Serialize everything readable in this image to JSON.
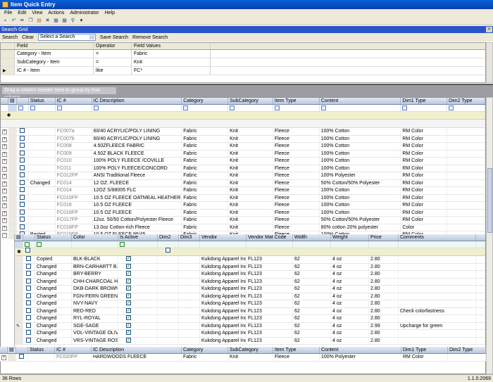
{
  "window": {
    "title": "Item Quick Entry"
  },
  "menu": [
    "File",
    "Edit",
    "View",
    "Actions",
    "Administrator",
    "Help"
  ],
  "search_grid": {
    "title": "Search Grid",
    "close": "×",
    "search_label": "Search",
    "clear_label": "Clear",
    "select_value": "Select a Search",
    "save_label": "Save Search",
    "remove_label": "Remove Search",
    "headers": [
      "Field",
      "Operator",
      "Field Values"
    ],
    "rows": [
      [
        "Category - Item",
        "=",
        "Fabric"
      ],
      [
        "SubCategory - Item",
        "=",
        "Knit"
      ],
      [
        "IC # - Item",
        "like",
        "FC*"
      ]
    ]
  },
  "group_hint": "Drag a column header here to group by that column.",
  "main_headers": [
    "Status",
    "IC #",
    "IC Description",
    "Category",
    "SubCategory",
    "Item Type",
    "Content",
    "Dim1 Type",
    "Dim2 Type"
  ],
  "main_rows": [
    [
      "",
      "FC007a",
      "60/40 ACRYLIC/POLY LINING",
      "Fabric",
      "Knit",
      "Fleece",
      "100% Cotton",
      "RM Color"
    ],
    [
      "",
      "FC007b",
      "60/40 ACRYLIC/POLY LINING",
      "Fabric",
      "Knit",
      "Fleece",
      "100% Cotton",
      "RM Color"
    ],
    [
      "",
      "FC008",
      "4.50ZFLEECE FABRIC",
      "Fabric",
      "Knit",
      "Fleece",
      "100% Cotton",
      "RM Color"
    ],
    [
      "",
      "FC009",
      "4.50Z BLACK FLEECE",
      "Fabric",
      "Knit",
      "Fleece",
      "100% Cotton",
      "RM Color"
    ],
    [
      "",
      "FC010",
      "100% POLY FLEECE /COVILLE",
      "Fabric",
      "Knit",
      "Fleece",
      "100% Cotton",
      "RM Color"
    ],
    [
      "",
      "FC011",
      "100% POLY FLEECE/CONCORD",
      "Fabric",
      "Knit",
      "Fleece",
      "100% Cotton",
      "RM Color"
    ],
    [
      "",
      "FC012FP",
      "ANSI Traditional Fleece",
      "Fabric",
      "Knit",
      "Fleece",
      "100% Polyester",
      "RM Color"
    ],
    [
      "Changed",
      "FC014",
      "12 OZ. FLEECE",
      "Fabric",
      "Knit",
      "Fleece",
      "50% Cotton/50% Polyester",
      "RM Color"
    ],
    [
      "",
      "FC014",
      "12OZ S/88005 FLC",
      "Fabric",
      "Knit",
      "Fleece",
      "100% Cotton",
      "RM Color"
    ],
    [
      "",
      "FC015FP",
      "10.5 OZ FLEECE OATMEAL HEATHER",
      "Fabric",
      "Knit",
      "Fleece",
      "100% Cotton",
      "RM Color"
    ],
    [
      "",
      "FC016",
      "10.5 OZ FLEECE",
      "Fabric",
      "Knit",
      "Fleece",
      "100% Cotton",
      "RM Color"
    ],
    [
      "",
      "FC016FP",
      "10.5 OZ FLEECE",
      "Fabric",
      "Knit",
      "Fleece",
      "100% Cotton",
      "RM Color"
    ],
    [
      "",
      "FC017FP",
      "12oz. 50/50 Cotton/Polyester Fleece",
      "Fabric",
      "Knit",
      "Fleece",
      "50% Cotton/50% Polyester",
      "RM Color"
    ],
    [
      "",
      "FC018FP",
      "13.0oz Cotton-rich Fleece",
      "Fabric",
      "Knit",
      "Fleece",
      "80% cotton 20% polyester",
      "Color"
    ],
    [
      "Pasted",
      "FC019FP",
      "10.5 OZ FLEECE 95/45",
      "Fabric",
      "Knit",
      "Fleece",
      "100% Cotton",
      "RM Color"
    ]
  ],
  "child_headers": [
    "Status",
    "Color",
    "Is Active",
    "Dim2",
    "Dim3",
    "Vendor",
    "Vendor Mat Code",
    "Width",
    "Weight",
    "Price",
    "Comments"
  ],
  "child_rows": [
    [
      "Copied",
      "BLK-BLACK",
      "Kukdong Apparel Inc.",
      "FL123",
      "62",
      "4 oz",
      "2.80",
      ""
    ],
    [
      "Changed",
      "BRN-CARHARTT B...",
      "Kukdong Apparel Inc.",
      "FL123",
      "62",
      "4 oz",
      "2.80",
      ""
    ],
    [
      "Changed",
      "BRY-BERRY",
      "Kukdong Apparel Inc.",
      "FL123",
      "62",
      "4 oz",
      "2.80",
      ""
    ],
    [
      "Changed",
      "CHH-CHARCOAL H...",
      "Kukdong Apparel Inc.",
      "FL123",
      "62",
      "4 oz",
      "2.80",
      ""
    ],
    [
      "Changed",
      "DKB-DARK BROWN",
      "Kukdong Apparel Inc.",
      "FL123",
      "62",
      "4 oz",
      "2.80",
      ""
    ],
    [
      "Changed",
      "FGN-FERN GREEN",
      "Kukdong Apparel Inc.",
      "FL123",
      "62",
      "4 oz",
      "2.80",
      ""
    ],
    [
      "Changed",
      "NVY-NAVY",
      "Kukdong Apparel Inc.",
      "FL123",
      "62",
      "4 oz",
      "2.80",
      ""
    ],
    [
      "Changed",
      "RED-RED",
      "Kukdong Apparel Inc.",
      "FL123",
      "62",
      "4 oz",
      "2.80",
      "Check colorfastness"
    ],
    [
      "Changed",
      "RYL-ROYAL",
      "Kukdong Apparel Inc.",
      "FL123",
      "62",
      "4 oz",
      "2.80",
      ""
    ],
    [
      "Changed",
      "SGE-SAGE",
      "Kukdong Apparel Inc.",
      "FL123",
      "62",
      "4 oz",
      "2.99",
      "Upcharge for green"
    ],
    [
      "Changed",
      "VOL-VINTAGE OLIVE",
      "Kukdong Apparel Inc.",
      "FL123",
      "62",
      "4 oz",
      "2.80",
      ""
    ],
    [
      "Changed",
      "VRS-VINTAGE ROSE",
      "Kukdong Apparel Inc.",
      "FL123",
      "62",
      "4 oz",
      "2.80",
      ""
    ]
  ],
  "bottom_row": [
    "",
    "FC020FP",
    "HARDWOODS FLEECE",
    "Fabric",
    "Knit",
    "Fleece",
    "100% Polyester",
    "RM Color"
  ],
  "status": {
    "rows": "36 Rows",
    "version": "1.1.0.2069"
  }
}
